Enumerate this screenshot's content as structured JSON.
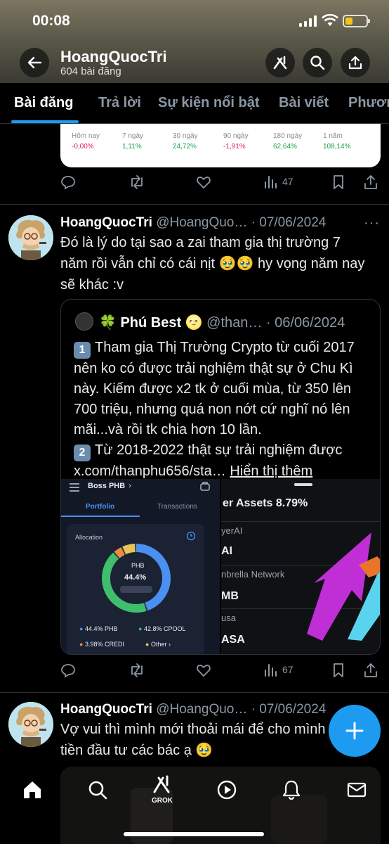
{
  "status": {
    "time": "00:08"
  },
  "header": {
    "name": "HoangQuocTri",
    "post_count": "604 bài đăng"
  },
  "tabs": [
    {
      "label": "Bài đăng",
      "active": true
    },
    {
      "label": "Trả lời"
    },
    {
      "label": "Sự kiện nổi bật"
    },
    {
      "label": "Bài viết"
    },
    {
      "label": "Phươn"
    }
  ],
  "stats": [
    {
      "label": "Hôm nay",
      "value": "-0,00%",
      "trend": "neg"
    },
    {
      "label": "7 ngày",
      "value": "1,11%",
      "trend": "pos"
    },
    {
      "label": "30 ngày",
      "value": "24,72%",
      "trend": "pos"
    },
    {
      "label": "90 ngày",
      "value": "-1,91%",
      "trend": "neg"
    },
    {
      "label": "180 ngày",
      "value": "62,64%",
      "trend": "pos"
    },
    {
      "label": "1 năm",
      "value": "108,14%",
      "trend": "pos"
    }
  ],
  "post0": {
    "views": "47"
  },
  "post1": {
    "name": "HoangQuocTri",
    "handle_date": "@HoangQuo… · 07/06/2024",
    "more": "···",
    "text": "Đó là lý do tại sao a zai tham gia thị trường 7 năm rồi vẫn chỉ có cái nịt 🥹🥹 hy vọng năm nay sẽ khác :v",
    "views": "67",
    "quote": {
      "name": "🍀 Phú Best 🌝",
      "handle_date": "@than… · 06/06/2024",
      "n1": "1",
      "line1": "Tham gia Thị Trường Crypto từ cuối 2017 nên ko có được trải nghiệm thật sự ở Chu Kì này. Kiếm được x2 tk ở cuối mùa, từ 350 lên 700 triệu,  nhưng quá non nớt cứ nghĩ nó lên mãi...và rồi tk chia hơn 10 lần.",
      "n2": "2",
      "line2": "Từ 2018-2022 thật sự trải nghiệm được",
      "link": "x.com/thanphu656/sta…",
      "show_more": "Hiển thị thêm",
      "img1": {
        "title": "Boss PHB",
        "tab_portfolio": "Portfolio",
        "tab_transactions": "Transactions",
        "allocation": "Allocation",
        "center_token": "PHB",
        "center_pct": "44.4%",
        "legend": [
          "44.4% PHB",
          "42.8% CPOOL",
          "3.98% CREDI",
          "Other"
        ]
      },
      "img2": {
        "heading": "er Assets 8.79%",
        "rows": [
          "yerAI",
          "AI",
          "nbrella Network",
          "MB",
          "usa",
          "ASA"
        ]
      }
    }
  },
  "post2": {
    "name": "HoangQuocTri",
    "handle_date": "@HoangQuo… · 07/06/2024",
    "text": "Vợ vui thì mình mới thoải mái để cho mình tiền đầu tư các bác ạ 🥹"
  },
  "nav": {
    "grok_label": "GROK"
  },
  "colors": {
    "accent": "#1d9bf0",
    "neg": "#e0245e",
    "pos": "#17a34a"
  }
}
